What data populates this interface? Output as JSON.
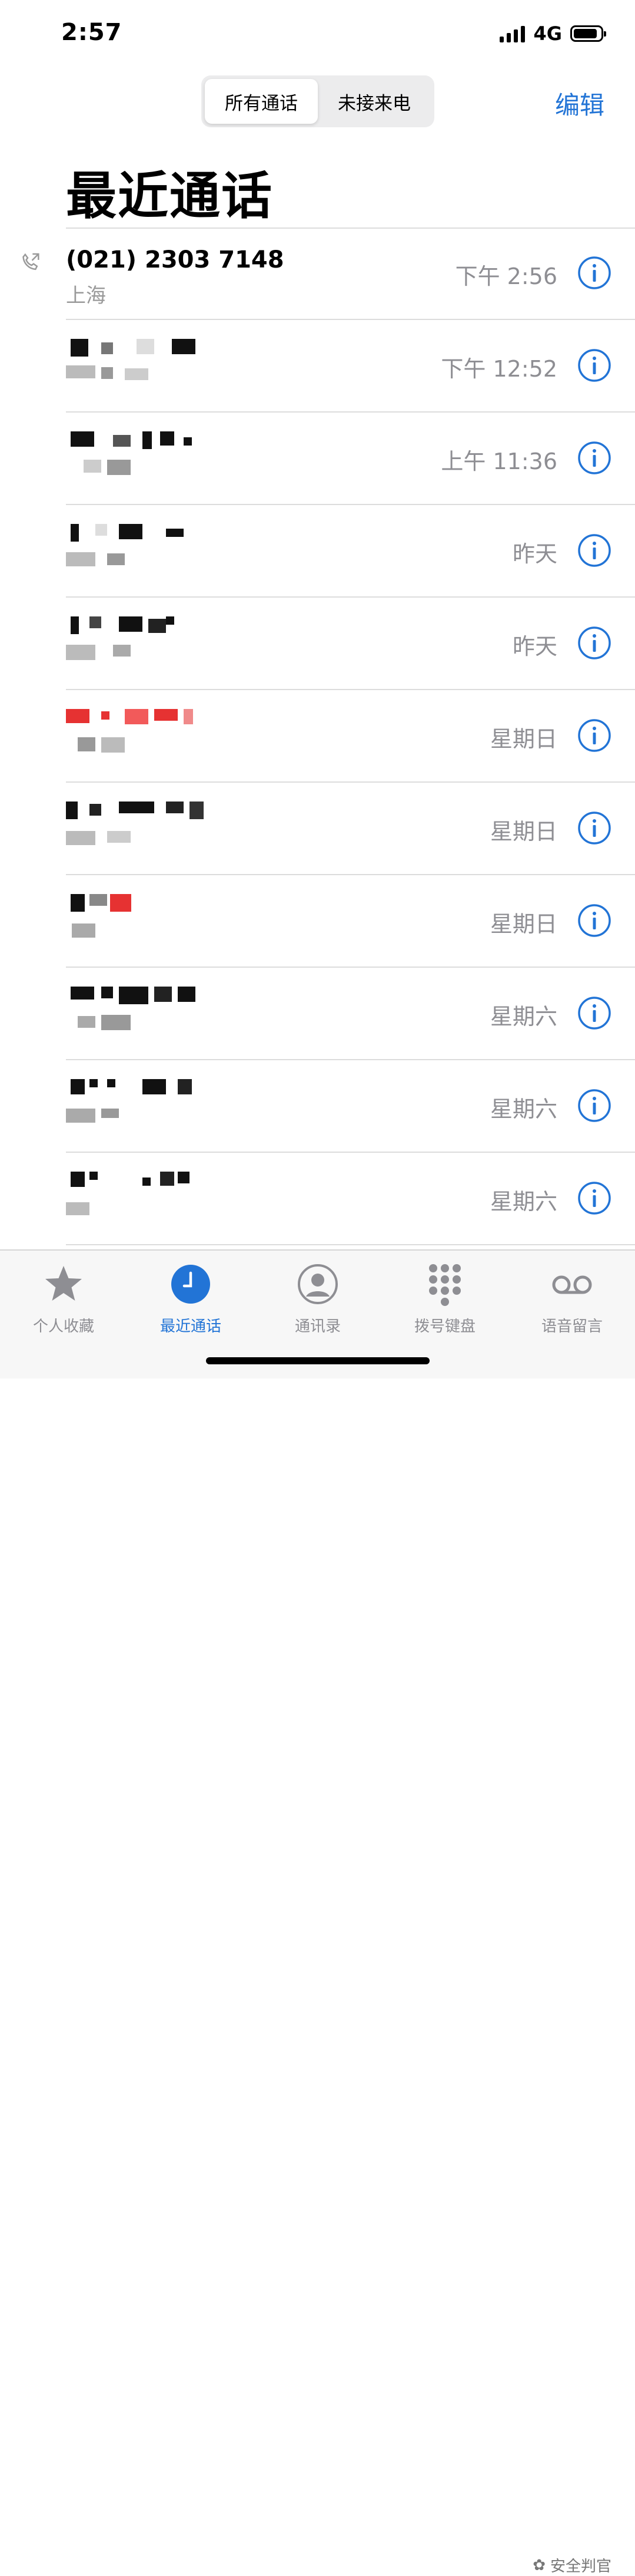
{
  "status": {
    "time": "2:57",
    "network": "4G"
  },
  "segment": {
    "all": "所有通话",
    "missed": "未接来电"
  },
  "edit_label": "编辑",
  "title": "最近通话",
  "calls": [
    {
      "name": "(021) 2303 7148",
      "sub": "上海",
      "time": "下午 2:56"
    },
    {
      "name": "",
      "sub": "",
      "time": "下午 12:52"
    },
    {
      "name": "",
      "sub": "",
      "time": "上午 11:36"
    },
    {
      "name": "",
      "sub": "",
      "time": "昨天"
    },
    {
      "name": "",
      "sub": "",
      "time": "昨天"
    },
    {
      "name": "",
      "sub": "",
      "time": "星期日"
    },
    {
      "name": "",
      "sub": "",
      "time": "星期日"
    },
    {
      "name": "",
      "sub": "",
      "time": "星期日"
    },
    {
      "name": "",
      "sub": "",
      "time": "星期六"
    },
    {
      "name": "",
      "sub": "",
      "time": "星期六"
    },
    {
      "name": "",
      "sub": "",
      "time": "星期六"
    }
  ],
  "tabs": [
    {
      "label": "个人收藏",
      "icon": "star-icon"
    },
    {
      "label": "最近通话",
      "icon": "clock-icon"
    },
    {
      "label": "通讯录",
      "icon": "person-icon"
    },
    {
      "label": "拨号键盘",
      "icon": "keypad-icon"
    },
    {
      "label": "语音留言",
      "icon": "voicemail-icon"
    }
  ],
  "watermark": "安全判官",
  "colors": {
    "accent": "#2274d6",
    "pixel_red": "#e63232"
  }
}
